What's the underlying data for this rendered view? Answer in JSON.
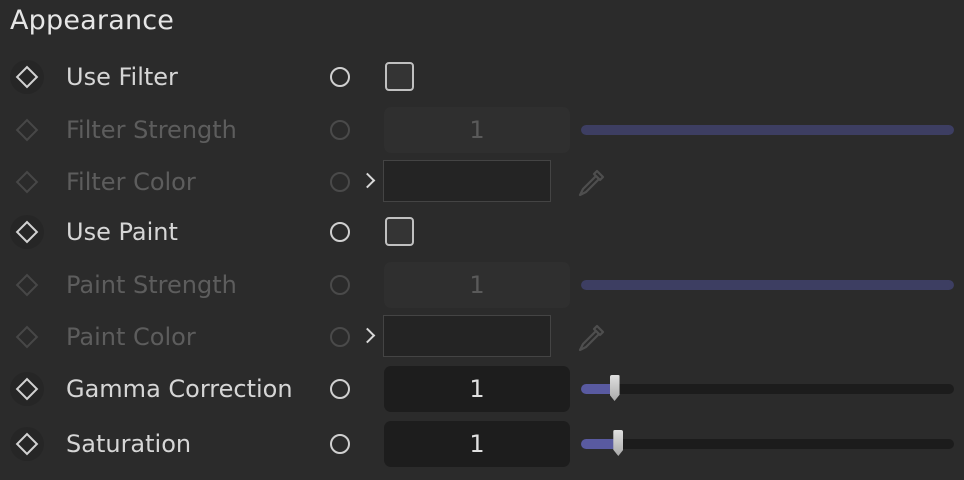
{
  "panel": {
    "title": "Appearance"
  },
  "rows": [
    {
      "label": "Use Filter"
    },
    {
      "label": "Filter Strength",
      "value": "1",
      "slider_fraction": 1.0
    },
    {
      "label": "Filter Color"
    },
    {
      "label": "Use Paint"
    },
    {
      "label": "Paint Strength",
      "value": "1",
      "slider_fraction": 1.0
    },
    {
      "label": "Paint Color"
    },
    {
      "label": "Gamma Correction",
      "value": "1",
      "slider_fraction": 0.09
    },
    {
      "label": "Saturation",
      "value": "1",
      "slider_fraction": 0.1
    }
  ],
  "colors": {
    "background": "#2b2b2b",
    "slider_fill": "#595aa0",
    "slider_fill_disabled": "#3d3e62",
    "text_enabled": "#d6d6d6",
    "text_disabled": "#5d5d5d"
  },
  "icons": {
    "keyframe": "diamond-icon",
    "animate": "circle-icon",
    "expand": "chevron-right-icon",
    "picker": "eyedropper-icon"
  }
}
